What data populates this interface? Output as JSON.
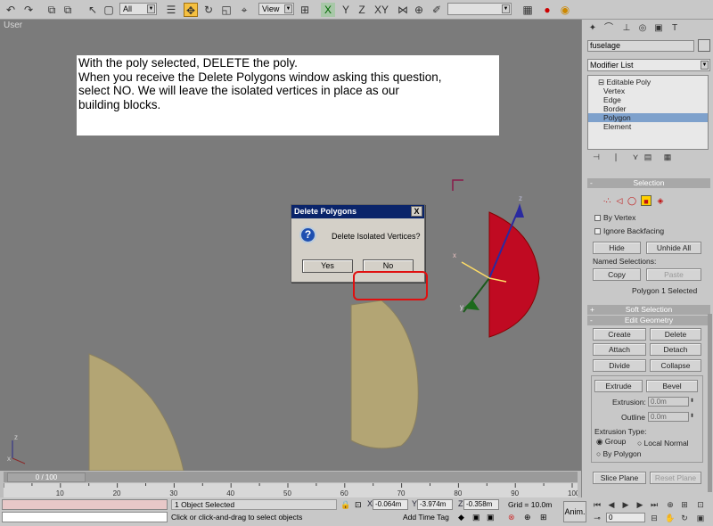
{
  "toolbar": {
    "selection_filter": "All",
    "reference_coord": "View",
    "named_selection": "",
    "icons": [
      "undo-icon",
      "redo-icon",
      "select-link-icon",
      "unlink-icon",
      "bind-spacewarp-icon",
      "select-object-icon",
      "select-region-icon",
      "select-by-name-icon",
      "select-move-icon",
      "select-rotate-icon",
      "select-scale-icon",
      "pivot-icon",
      "mirror-icon",
      "align-icon",
      "snap-icon",
      "angle-snap-icon",
      "percent-snap-icon",
      "spinner-snap-icon",
      "material-editor-icon",
      "render-icon",
      "quick-render-icon"
    ],
    "axis_labels": [
      "X",
      "Y",
      "Z",
      "XY"
    ]
  },
  "viewport": {
    "label": "User",
    "instructions": [
      "With the poly selected, DELETE the poly.",
      "When you receive the Delete Polygons window asking this question,",
      "select NO.  We will leave the isolated vertices in place as our",
      "building blocks."
    ],
    "gizmo_axes": {
      "x": "x",
      "y": "y",
      "z": "z"
    },
    "world_axis": {
      "z": "z",
      "x": "x"
    },
    "colors": {
      "background": "#7b7b7b",
      "red_shape": "#c00a22",
      "tan_shape": "#b3a574"
    }
  },
  "dialog": {
    "title": "Delete Polygons",
    "close": "X",
    "message": "Delete Isolated Vertices?",
    "yes_label": "Yes",
    "no_label": "No"
  },
  "command_panel": {
    "object_name": "fuselage",
    "modifier_list": "Modifier List",
    "stack": {
      "root": "Editable Poly",
      "items": [
        "Vertex",
        "Edge",
        "Border",
        "Polygon",
        "Element"
      ],
      "selected": "Polygon"
    },
    "selection": {
      "title": "Selection",
      "by_vertex": "By Vertex",
      "ignore_backfacing": "Ignore Backfacing",
      "hide": "Hide",
      "unhide_all": "Unhide All",
      "named_selections": "Named Selections:",
      "copy": "Copy",
      "paste": "Paste",
      "status": "Polygon 1 Selected"
    },
    "soft_selection": {
      "title": "Soft Selection"
    },
    "edit_geometry": {
      "title": "Edit Geometry",
      "create": "Create",
      "delete": "Delete",
      "attach": "Attach",
      "detach": "Detach",
      "divide": "Divide",
      "collapse": "Collapse",
      "extrude": "Extrude",
      "bevel": "Bevel",
      "extrusion_label": "Extrusion:",
      "extrusion_value": "0.0m",
      "outline_label": "Outline",
      "outline_value": "0.0m",
      "extrusion_type": "Extrusion Type:",
      "group": "Group",
      "local_normal": "Local Normal",
      "by_polygon": "By Polygon",
      "slice_plane": "Slice Plane",
      "reset_plane": "Reset Plane"
    }
  },
  "timeline": {
    "thumb": "0 / 100",
    "ticks": [
      "10",
      "20",
      "30",
      "40",
      "50",
      "60",
      "70",
      "80",
      "90",
      "100"
    ]
  },
  "status": {
    "selected": "1 Object Selected",
    "prompt": "Click or click-and-drag to select objects",
    "x_label": "X",
    "x_value": "-0.064m",
    "y_label": "Y",
    "y_value": "-3.974m",
    "z_label": "Z",
    "z_value": "-0.358m",
    "grid": "Grid = 10.0m",
    "add_time_tag": "Add Time Tag",
    "anim": "Anim.",
    "frame": "0"
  }
}
